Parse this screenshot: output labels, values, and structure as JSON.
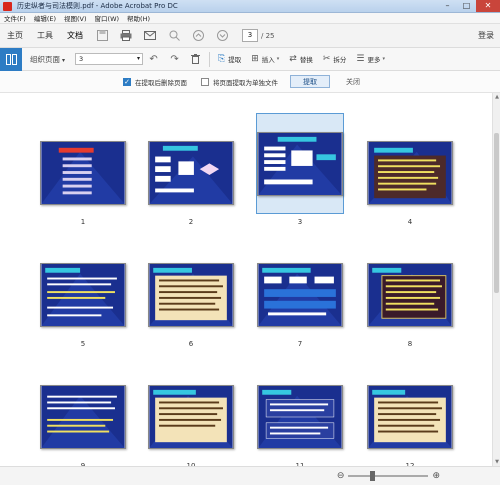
{
  "window": {
    "title": "历史纵者与司法模则.pdf - Adobe Acrobat Pro DC"
  },
  "menu": [
    "文件(F)",
    "编辑(E)",
    "视图(V)",
    "窗口(W)",
    "帮助(H)"
  ],
  "toolbar": {
    "tabs": [
      "主页",
      "工具",
      "文档"
    ],
    "current_page": "3",
    "total_pages": "/ 25",
    "signin": "登录"
  },
  "organize": {
    "title": "组织页面",
    "range_value": "3",
    "extract_label": "提取",
    "insert_label": "插入",
    "replace_label": "替换",
    "split_label": "拆分",
    "more_label": "更多"
  },
  "extract_options": {
    "delete_after": "在提取后删除页面",
    "separate_files": "将页面提取为单独文件",
    "extract_button": "提取",
    "close_button": "关闭"
  },
  "pages": [
    "1",
    "2",
    "3",
    "4",
    "5",
    "6",
    "7",
    "8",
    "9",
    "10",
    "11",
    "12"
  ],
  "selected_page": "3",
  "colors": {
    "accent": "#2d7cc4",
    "slide_bg": "#1a2f8f",
    "selection": "#d9e8f6"
  }
}
